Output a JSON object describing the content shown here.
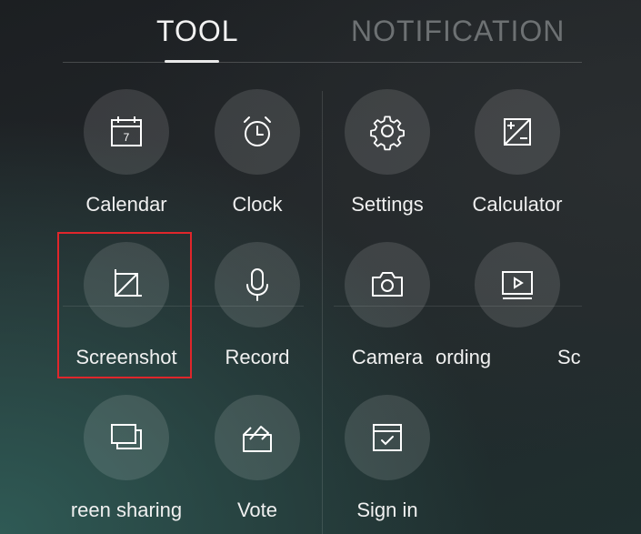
{
  "tabs": {
    "tool": "TOOL",
    "notification": "NOTIFICATION"
  },
  "tools": {
    "calendar": {
      "label": "Calendar",
      "icon": "calendar-icon",
      "date": "7"
    },
    "clock": {
      "label": "Clock",
      "icon": "clock-icon"
    },
    "settings": {
      "label": "Settings",
      "icon": "gear-icon"
    },
    "calculator": {
      "label": "Calculator",
      "icon": "calculator-icon"
    },
    "screenshot": {
      "label": "Screenshot",
      "icon": "crop-icon"
    },
    "record": {
      "label": "Record",
      "icon": "microphone-icon"
    },
    "camera": {
      "label": "Camera",
      "icon": "camera-icon"
    },
    "recording": {
      "label": "ording",
      "icon": "video-play-icon"
    },
    "partial": {
      "label": "Sc"
    },
    "screen_sharing": {
      "label": "reen sharing",
      "icon": "screen-share-icon"
    },
    "vote": {
      "label": "Vote",
      "icon": "vote-box-icon"
    },
    "sign_in": {
      "label": "Sign in",
      "icon": "sign-in-check-icon"
    }
  },
  "colors": {
    "highlight": "#e0262b",
    "tab_active": "#f2f2f2",
    "tab_inactive": "#6d7173"
  }
}
